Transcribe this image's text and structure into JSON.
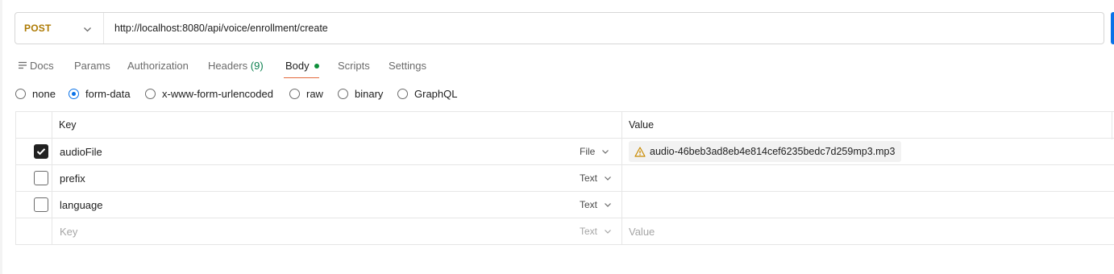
{
  "request": {
    "method": "POST",
    "url": "http://localhost:8080/api/voice/enrollment/create"
  },
  "tabs": [
    {
      "label": "Docs"
    },
    {
      "label": "Params"
    },
    {
      "label": "Authorization"
    },
    {
      "label": "Headers",
      "count": "(9)"
    },
    {
      "label": "Body",
      "active": true
    },
    {
      "label": "Scripts"
    },
    {
      "label": "Settings"
    }
  ],
  "body_types": [
    {
      "label": "none",
      "selected": false
    },
    {
      "label": "form-data",
      "selected": true
    },
    {
      "label": "x-www-form-urlencoded",
      "selected": false
    },
    {
      "label": "raw",
      "selected": false
    },
    {
      "label": "binary",
      "selected": false
    },
    {
      "label": "GraphQL",
      "selected": false
    }
  ],
  "table": {
    "key_header": "Key",
    "value_header": "Value",
    "rows": [
      {
        "checked": true,
        "key": "audioFile",
        "type": "File",
        "value": "audio-46beb3ad8eb4e814cef6235bedc7d259mp3.mp3",
        "warning_icon": "warning-icon"
      },
      {
        "checked": false,
        "key": "prefix",
        "type": "Text",
        "value": ""
      },
      {
        "checked": false,
        "key": "language",
        "type": "Text",
        "value": ""
      }
    ],
    "new_row": {
      "key_placeholder": "Key",
      "type": "Text",
      "value_placeholder": "Value"
    }
  },
  "colors": {
    "method": "#ad7a03",
    "accent": "#0a72e8",
    "active_tab_underline": "#e3693c",
    "body_dot": "#0d8f3a",
    "warning": "#c98a00"
  }
}
